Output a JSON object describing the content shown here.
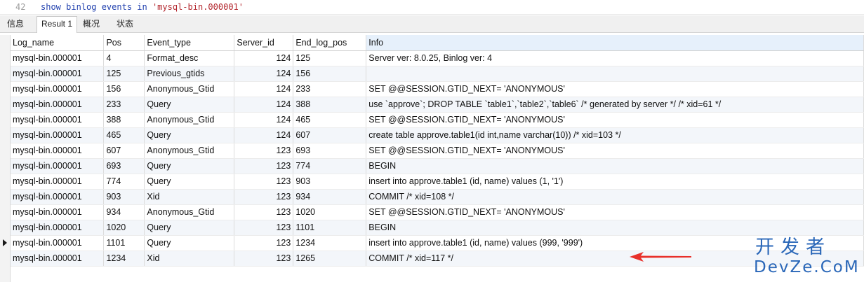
{
  "editor": {
    "line_number": "42",
    "sql_keyword": "show binlog events in",
    "sql_string": "'mysql-bin.000001'"
  },
  "tabs": [
    "信息",
    "Result 1",
    "概况",
    "状态"
  ],
  "active_tab": "Result 1",
  "columns": [
    "Log_name",
    "Pos",
    "Event_type",
    "Server_id",
    "End_log_pos",
    "Info"
  ],
  "rows": [
    [
      "mysql-bin.000001",
      "4",
      "Format_desc",
      "124",
      "125",
      "Server ver: 8.0.25, Binlog ver: 4"
    ],
    [
      "mysql-bin.000001",
      "125",
      "Previous_gtids",
      "124",
      "156",
      ""
    ],
    [
      "mysql-bin.000001",
      "156",
      "Anonymous_Gtid",
      "124",
      "233",
      "SET @@SESSION.GTID_NEXT= 'ANONYMOUS'"
    ],
    [
      "mysql-bin.000001",
      "233",
      "Query",
      "124",
      "388",
      "use `approve`; DROP TABLE `table1`,`table2`,`table6` /* generated by server */ /* xid=61 */"
    ],
    [
      "mysql-bin.000001",
      "388",
      "Anonymous_Gtid",
      "124",
      "465",
      "SET @@SESSION.GTID_NEXT= 'ANONYMOUS'"
    ],
    [
      "mysql-bin.000001",
      "465",
      "Query",
      "124",
      "607",
      "create table approve.table1(id int,name varchar(10)) /* xid=103 */"
    ],
    [
      "mysql-bin.000001",
      "607",
      "Anonymous_Gtid",
      "123",
      "693",
      "SET @@SESSION.GTID_NEXT= 'ANONYMOUS'"
    ],
    [
      "mysql-bin.000001",
      "693",
      "Query",
      "123",
      "774",
      "BEGIN"
    ],
    [
      "mysql-bin.000001",
      "774",
      "Query",
      "123",
      "903",
      "insert into approve.table1 (id, name) values (1, '1')"
    ],
    [
      "mysql-bin.000001",
      "903",
      "Xid",
      "123",
      "934",
      "COMMIT /* xid=108 */"
    ],
    [
      "mysql-bin.000001",
      "934",
      "Anonymous_Gtid",
      "123",
      "1020",
      "SET @@SESSION.GTID_NEXT= 'ANONYMOUS'"
    ],
    [
      "mysql-bin.000001",
      "1020",
      "Query",
      "123",
      "1101",
      "BEGIN"
    ],
    [
      "mysql-bin.000001",
      "1101",
      "Query",
      "123",
      "1234",
      "insert into approve.table1 (id, name) values (999, '999')"
    ],
    [
      "mysql-bin.000001",
      "1234",
      "Xid",
      "123",
      "1265",
      "COMMIT /* xid=117 */"
    ]
  ],
  "selected_row": 12,
  "watermark": {
    "cn": "开发者",
    "en": "DevZe.CoM"
  },
  "colors": {
    "accent_arrow": "#e8302a",
    "watermark": "#2a67b8",
    "header_highlight": "#e6f0fb"
  }
}
